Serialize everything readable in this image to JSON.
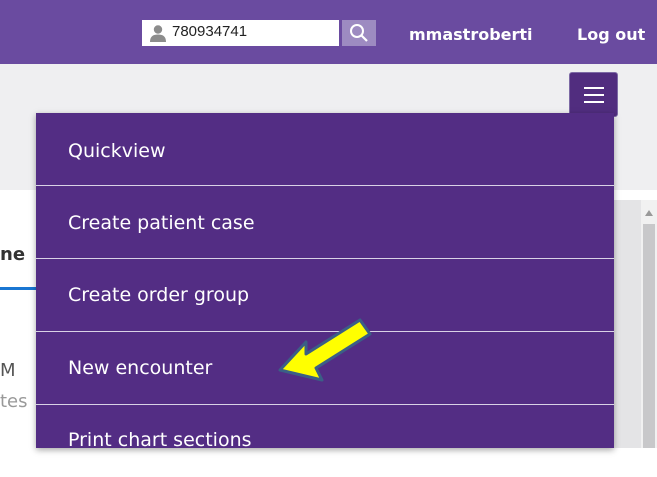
{
  "header": {
    "search": {
      "value": "780934741"
    },
    "username": "mmastroberti",
    "logout_label": "Log out"
  },
  "background": {
    "tab_fragment": "ne",
    "text_fragment_1": "M",
    "text_fragment_2": "tes"
  },
  "menu": {
    "items": [
      {
        "label": "Quickview"
      },
      {
        "label": "Create patient case"
      },
      {
        "label": "Create order group"
      },
      {
        "label": "New encounter"
      },
      {
        "label": "Print chart sections"
      }
    ]
  },
  "colors": {
    "topbar": "#6a4ba0",
    "menu_bg": "#532d84",
    "search_button": "#9d8bc1",
    "annotation_arrow": "#ffff00"
  },
  "icons": {
    "person": "person-icon",
    "search": "search-icon",
    "menu": "hamburger-icon",
    "annotation": "arrow-annotation-icon"
  }
}
